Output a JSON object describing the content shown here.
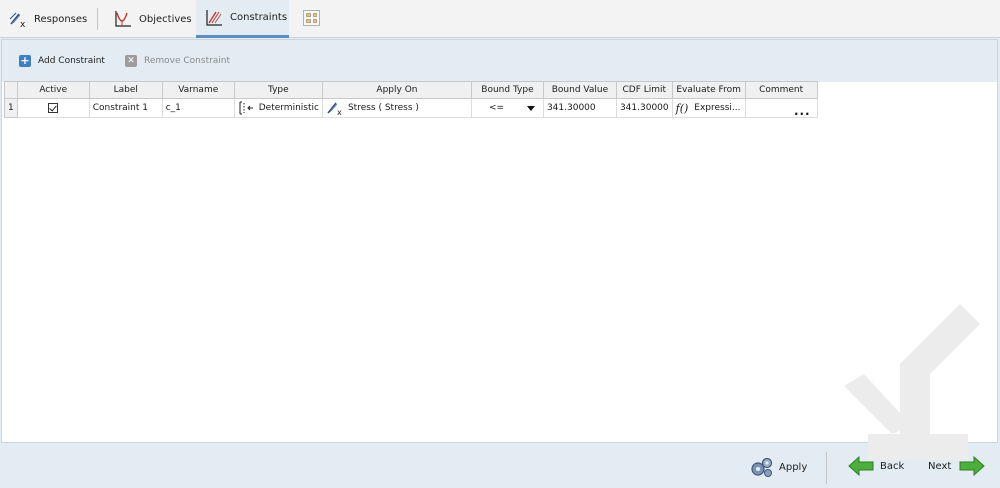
{
  "tabs": [
    {
      "label": "Responses",
      "icon": "response-function-icon",
      "active": false
    },
    {
      "label": "Objectives",
      "icon": "objective-chart-icon",
      "active": false
    },
    {
      "label": "Constraints",
      "icon": "constraint-chart-icon",
      "active": true
    }
  ],
  "toolbar": {
    "add_label": "Add Constraint",
    "remove_label": "Remove Constraint"
  },
  "table": {
    "columns": [
      "Active",
      "Label",
      "Varname",
      "Type",
      "Apply On",
      "Bound Type",
      "Bound Value",
      "CDF Limit",
      "Evaluate From",
      "Comment"
    ],
    "rows": [
      {
        "row_number": "1",
        "active": true,
        "label": "Constraint 1",
        "varname": "c_1",
        "type": "Deterministic",
        "apply_on": "Stress ( Stress )",
        "bound_type": "<=",
        "bound_value": "341.30000",
        "cdf_limit": "341.30000",
        "evaluate_from_symbol": "f()",
        "evaluate_from": "Expressi...",
        "comment": "..."
      }
    ]
  },
  "footer": {
    "apply_label": "Apply",
    "back_label": "Back",
    "next_label": "Next"
  },
  "colors": {
    "accent": "#5a8fc0",
    "arrow_green": "#4cae3b",
    "background": "#e3ecf3"
  }
}
